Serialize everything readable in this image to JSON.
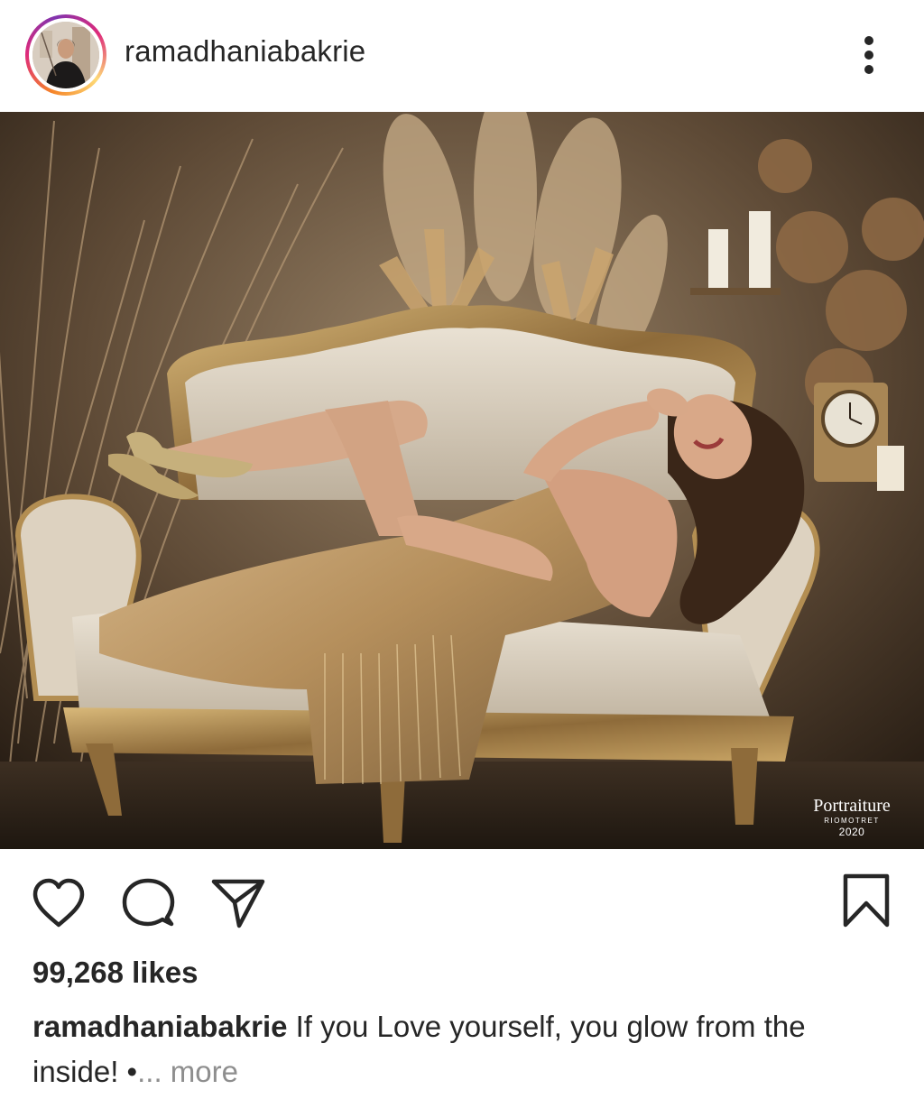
{
  "post": {
    "username": "ramadhaniabakrie",
    "avatar_icon": "profile-avatar",
    "more_icon": "more-vertical-icon",
    "photo": {
      "description_icon": "post-photo",
      "watermark": {
        "brand": "Portraiture",
        "sub": "RIOMOTRET",
        "year": "2020"
      }
    },
    "actions": {
      "like_icon": "heart-icon",
      "comment_icon": "comment-icon",
      "share_icon": "send-icon",
      "save_icon": "bookmark-icon"
    },
    "likes": "99,268 likes",
    "caption": {
      "username": "ramadhaniabakrie",
      "text": "If you Love yourself, you glow from the inside! •",
      "more": "... more"
    }
  },
  "colors": {
    "text": "#262626",
    "muted": "#8e8e8e",
    "story_ring_start": "#f58529",
    "story_ring_end": "#dd2a7b"
  }
}
